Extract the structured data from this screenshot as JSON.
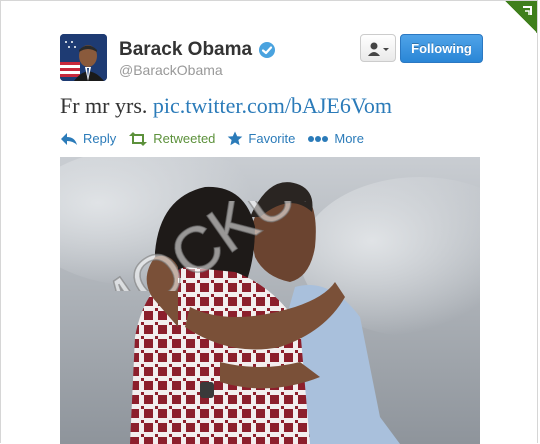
{
  "tweet": {
    "author": {
      "name": "Barack Obama",
      "handle": "@BarackObama",
      "verified": true
    },
    "follow_label": "Following",
    "text_plain": "Fr mr yrs.",
    "text_link": "pic.twitter.com/bAJE6Vom",
    "actions": {
      "reply": "Reply",
      "retweeted": "Retweeted",
      "favorite": "Favorite",
      "more": "More"
    }
  },
  "overlay": {
    "watermark": "MOCKUP"
  },
  "colors": {
    "link": "#2b7bb9",
    "retweeted": "#5c913b",
    "follow_button": "#2a86d6",
    "verified_badge": "#4aa3df"
  },
  "icons": [
    "verified-badge-icon",
    "user-dropdown-icon",
    "reply-icon",
    "retweet-icon",
    "favorite-star-icon",
    "more-dots-icon",
    "corner-badge-icon"
  ]
}
